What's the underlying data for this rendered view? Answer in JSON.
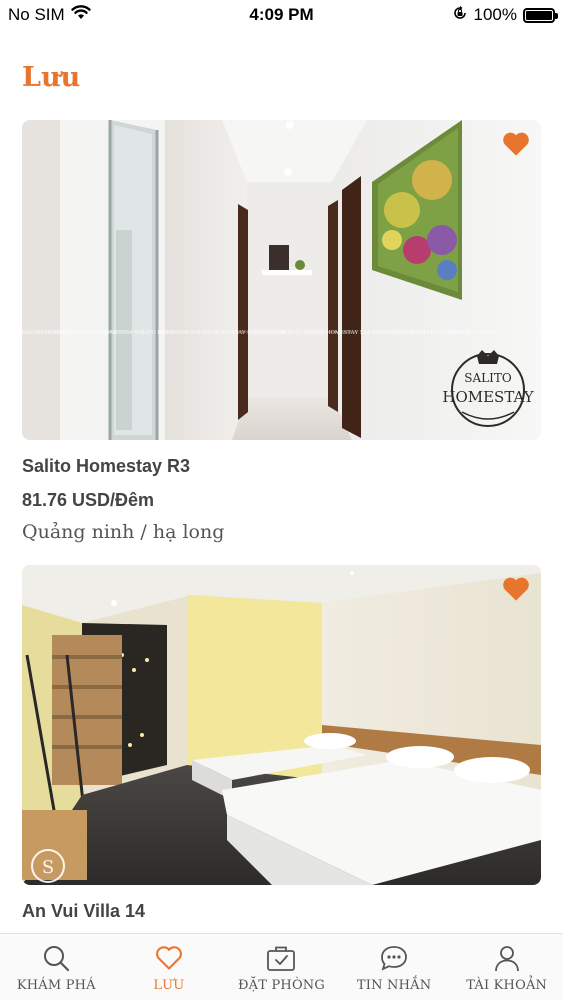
{
  "status_bar": {
    "carrier": "No SIM",
    "time": "4:09 PM",
    "battery": "100%"
  },
  "page": {
    "title": "Lưu"
  },
  "listings": [
    {
      "name": "Salito Homestay R3",
      "price": "81.76 USD/Đêm",
      "location": "Quảng ninh / hạ long",
      "favorited": true,
      "watermark": "SALITO HOMESTAY",
      "logo_top": "SALITO",
      "logo_bottom": "HOMESTAY"
    },
    {
      "name": "An Vui Villa 14",
      "favorited": true,
      "logo_letter": "S"
    }
  ],
  "tabs": [
    {
      "label": "KHÁM PHÁ",
      "icon": "search-icon",
      "active": false
    },
    {
      "label": "LƯU",
      "icon": "heart-icon",
      "active": true
    },
    {
      "label": "ĐẶT PHÒNG",
      "icon": "briefcase-check-icon",
      "active": false
    },
    {
      "label": "TIN NHẮN",
      "icon": "chat-bubble-icon",
      "active": false
    },
    {
      "label": "TÀI KHOẢN",
      "icon": "user-icon",
      "active": false
    }
  ],
  "colors": {
    "accent": "#e8752e",
    "text": "#444444",
    "tab_inactive": "#555555"
  }
}
